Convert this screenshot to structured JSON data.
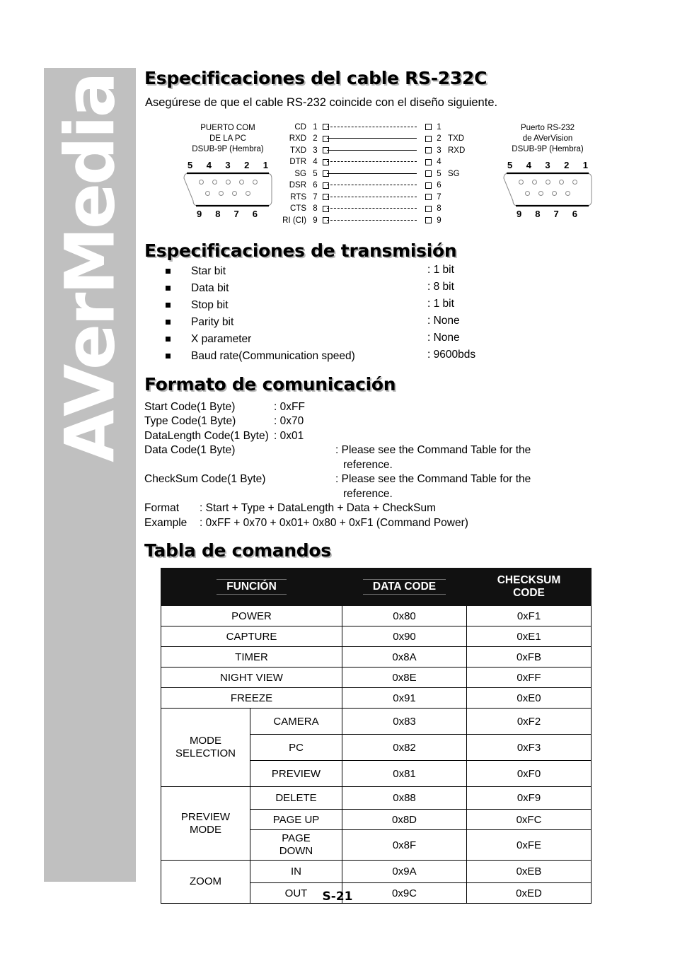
{
  "brand": {
    "name": "AVerMedia"
  },
  "footer": {
    "page": "S-21"
  },
  "sections": {
    "cable": {
      "heading": "Especificaciones del cable RS-232C",
      "intro": "Asegúrese de que el cable RS-232 coincide con el diseño siguiente."
    },
    "transmission": {
      "heading": "Especificaciones de transmisión"
    },
    "format": {
      "heading": "Formato de comunicación"
    },
    "table": {
      "heading": "Tabla de comandos"
    }
  },
  "diagram": {
    "pc_connector": {
      "title_line1": "PUERTO COM",
      "title_line2": "DE LA PC",
      "title_line3": "DSUB-9P (Hembra)",
      "top_pins": [
        "5",
        "4",
        "3",
        "2",
        "1"
      ],
      "bottom_pins": [
        "9",
        "8",
        "7",
        "6"
      ]
    },
    "av_connector": {
      "title_line1": "Puerto RS-232",
      "title_line2": "de AVerVision",
      "title_line3": "DSUB-9P (Hembra)",
      "top_pins": [
        "5",
        "4",
        "3",
        "2",
        "1"
      ],
      "bottom_pins": [
        "9",
        "8",
        "7",
        "6"
      ]
    },
    "left_pins": [
      {
        "signal": "CD",
        "number": "1"
      },
      {
        "signal": "RXD",
        "number": "2"
      },
      {
        "signal": "TXD",
        "number": "3"
      },
      {
        "signal": "DTR",
        "number": "4"
      },
      {
        "signal": "SG",
        "number": "5"
      },
      {
        "signal": "DSR",
        "number": "6"
      },
      {
        "signal": "RTS",
        "number": "7"
      },
      {
        "signal": "CTS",
        "number": "8"
      },
      {
        "signal": "RI (CI)",
        "number": "9"
      }
    ],
    "right_pins": [
      {
        "number": "1",
        "signal": ""
      },
      {
        "number": "2",
        "signal": "TXD"
      },
      {
        "number": "3",
        "signal": "RXD"
      },
      {
        "number": "4",
        "signal": ""
      },
      {
        "number": "5",
        "signal": "SG"
      },
      {
        "number": "6",
        "signal": ""
      },
      {
        "number": "7",
        "signal": ""
      },
      {
        "number": "8",
        "signal": ""
      },
      {
        "number": "9",
        "signal": ""
      }
    ],
    "wires": [
      "dashed",
      "solid",
      "solid",
      "dashed",
      "solid",
      "dashed",
      "dashed",
      "dashed",
      "dashed"
    ]
  },
  "transmission_specs": [
    {
      "label": "Star bit",
      "value": ": 1 bit"
    },
    {
      "label": "Data bit",
      "value": ": 8 bit"
    },
    {
      "label": "Stop bit",
      "value": ": 1 bit"
    },
    {
      "label": "Parity bit",
      "value": ": None"
    },
    {
      "label": "X parameter",
      "value": ": None"
    },
    {
      "label": "Baud rate(Communication speed)",
      "value": ": 9600bds"
    }
  ],
  "format_lines": {
    "start_code_key": "Start Code(1 Byte)",
    "start_code_val": ": 0xFF",
    "type_code_key": "Type Code(1 Byte)",
    "type_code_val": ": 0x70",
    "datalength_key": "DataLength Code(1 Byte)",
    "datalength_val": ": 0x01",
    "data_code_key": "Data Code(1 Byte)",
    "data_code_val": ": Please see the Command Table for the",
    "data_code_val2": "reference.",
    "checksum_key": "CheckSum Code(1 Byte)",
    "checksum_val": ": Please see the Command Table for the",
    "checksum_val2": "reference.",
    "format_key": "Format",
    "format_val": ": Start   + Type + DataLength + Data + CheckSum",
    "example_key": "Example",
    "example_val": ": 0xFF + 0x70 + 0x01+ 0x80 + 0xF1 (Command Power)"
  },
  "command_table": {
    "headers": {
      "function": "FUNCIÓN",
      "data_code": "DATA CODE",
      "checksum_line1": "CHECKSUM",
      "checksum_line2": "CODE"
    },
    "simple_rows": [
      {
        "function": "POWER",
        "data": "0x80",
        "checksum": "0xF1"
      },
      {
        "function": "CAPTURE",
        "data": "0x90",
        "checksum": "0xE1"
      },
      {
        "function": "TIMER",
        "data": "0x8A",
        "checksum": "0xFB"
      },
      {
        "function": "NIGHT VIEW",
        "data": "0x8E",
        "checksum": "0xFF"
      },
      {
        "function": "FREEZE",
        "data": "0x91",
        "checksum": "0xE0"
      }
    ],
    "groups": [
      {
        "name_line1": "MODE",
        "name_line2": "SELECTION",
        "rows": [
          {
            "sub": "CAMERA",
            "data": "0x83",
            "checksum": "0xF2"
          },
          {
            "sub": "PC",
            "data": "0x82",
            "checksum": "0xF3"
          },
          {
            "sub": "PREVIEW",
            "data": "0x81",
            "checksum": "0xF0"
          }
        ]
      },
      {
        "name_line1": "PREVIEW",
        "name_line2": "MODE",
        "rows": [
          {
            "sub": "DELETE",
            "data": "0x88",
            "checksum": "0xF9"
          },
          {
            "sub": "PAGE UP",
            "data": "0x8D",
            "checksum": "0xFC"
          },
          {
            "sub": "PAGE\nDOWN",
            "data": "0x8F",
            "checksum": "0xFE"
          }
        ]
      },
      {
        "name_line1": "ZOOM",
        "name_line2": "",
        "rows": [
          {
            "sub": "IN",
            "data": "0x9A",
            "checksum": "0xEB"
          },
          {
            "sub": "OUT",
            "data": "0x9C",
            "checksum": "0xED"
          }
        ]
      }
    ]
  },
  "colors": {
    "sidebar_gray": "#c0c0c0",
    "header_black": "#111111",
    "heading_shadow": "#b9b9b9"
  }
}
